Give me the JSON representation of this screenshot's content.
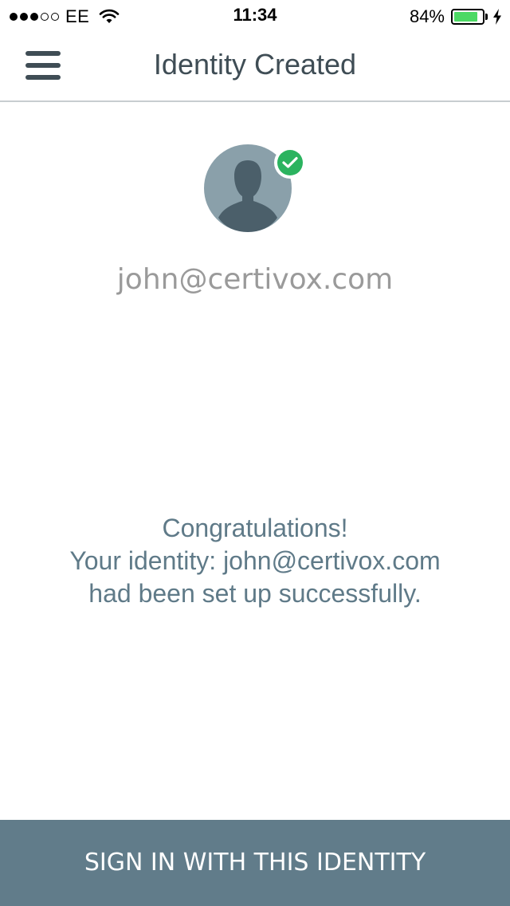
{
  "status_bar": {
    "signal": {
      "full": 3,
      "empty": 2
    },
    "carrier": "EE",
    "time": "11:34",
    "battery_percent_label": "84%",
    "battery_level": 0.84,
    "wifi_icon": "wifi-icon",
    "charging_icon": "charging-bolt-icon"
  },
  "nav": {
    "title": "Identity Created",
    "menu_icon": "hamburger-menu-icon"
  },
  "identity": {
    "avatar_icon": "user-silhouette-icon",
    "badge_icon": "checkmark-icon",
    "email": "john@certivox.com"
  },
  "message": {
    "line1": "Congratulations!",
    "line2": "Your identity: john@certivox.com",
    "line3": "had been set up successfully."
  },
  "actions": {
    "signin_label": "SIGN IN WITH THIS IDENTITY"
  },
  "colors": {
    "accent_button": "#617c8a",
    "success_badge": "#2bb35f",
    "title_text": "#3f4d55",
    "message_text": "#5f7a88",
    "battery_fill": "#4cd964"
  }
}
